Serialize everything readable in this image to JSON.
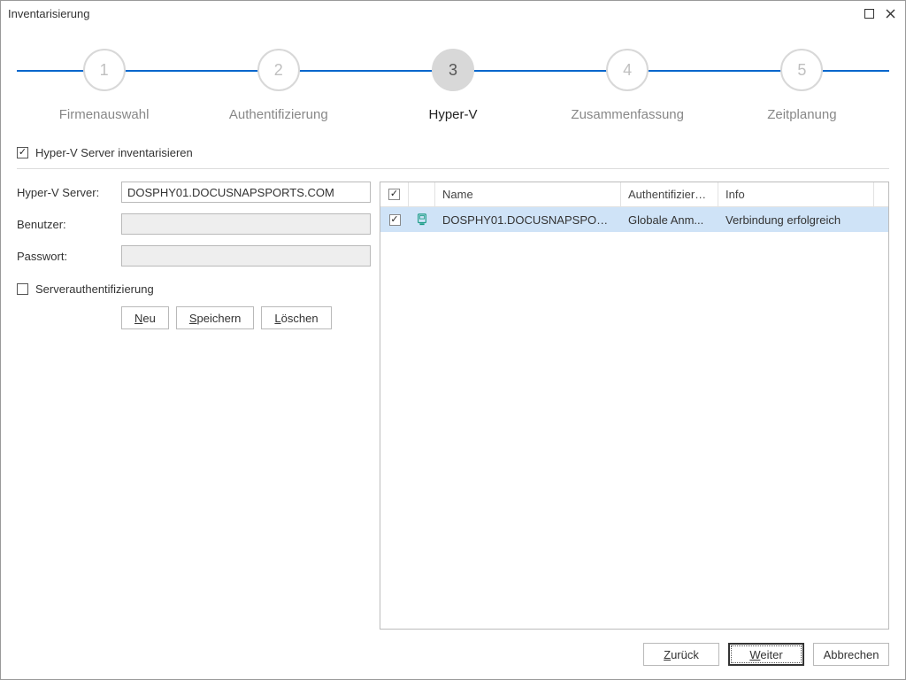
{
  "window": {
    "title": "Inventarisierung"
  },
  "wizard": {
    "steps": [
      {
        "num": "1",
        "label": "Firmenauswahl"
      },
      {
        "num": "2",
        "label": "Authentifizierung"
      },
      {
        "num": "3",
        "label": "Hyper-V"
      },
      {
        "num": "4",
        "label": "Zusammenfassung"
      },
      {
        "num": "5",
        "label": "Zeitplanung"
      }
    ],
    "active_index": 2
  },
  "form": {
    "inventory_checkbox_label": "Hyper-V Server inventarisieren",
    "server_label": "Hyper-V Server:",
    "server_value": "DOSPHY01.DOCUSNAPSPORTS.COM",
    "user_label": "Benutzer:",
    "user_value": "",
    "pass_label": "Passwort:",
    "pass_value": "",
    "serverauth_label": "Serverauthentifizierung",
    "buttons": {
      "new": "Neu",
      "save": "Speichern",
      "delete": "Löschen"
    }
  },
  "grid": {
    "headers": {
      "name": "Name",
      "auth": "Authentifizieru...",
      "info": "Info"
    },
    "rows": [
      {
        "checked": true,
        "name": "DOSPHY01.DOCUSNAPSPOR...",
        "auth": "Globale Anm...",
        "info": "Verbindung erfolgreich"
      }
    ]
  },
  "footer": {
    "back": "Zurück",
    "next": "Weiter",
    "cancel": "Abbrechen"
  }
}
